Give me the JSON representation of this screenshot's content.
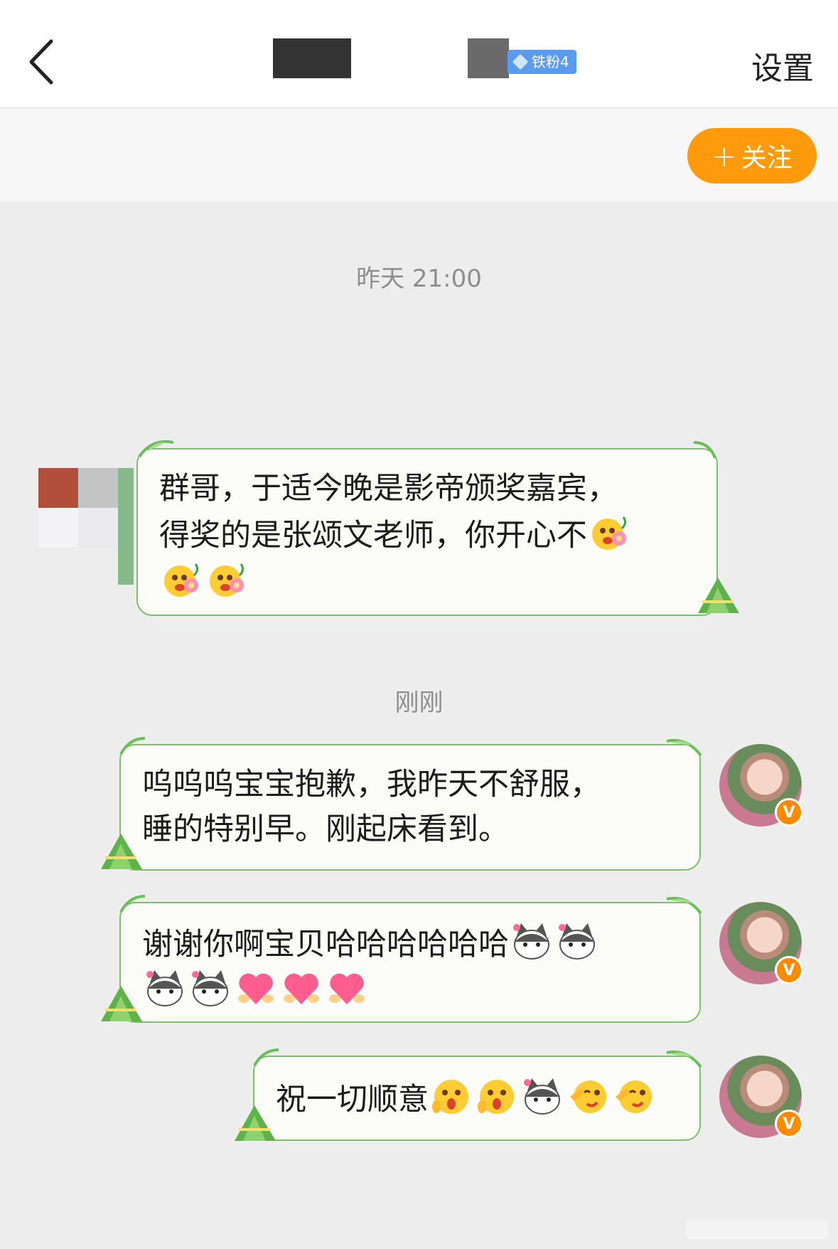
{
  "header": {
    "settings_label": "设置",
    "fan_badge": "铁粉4"
  },
  "follow_button": {
    "label": "关注",
    "icon": "plus-icon"
  },
  "timestamps": [
    "昨天 21:00",
    "刚刚"
  ],
  "messages": [
    {
      "side": "left",
      "line1": "群哥，于适今晚是影帝颁奖嘉宾，",
      "line2": "得奖的是张颂文老师，你开心不",
      "emojis_line2": [
        "flower-face-emoji"
      ],
      "emojis_line3": [
        "flower-face-emoji",
        "flower-face-emoji"
      ]
    },
    {
      "side": "right",
      "line1": "呜呜呜宝宝抱歉，我昨天不舒服，",
      "line2": "睡的特别早。刚起床看到。"
    },
    {
      "side": "right",
      "line1": "谢谢你啊宝贝哈哈哈哈哈哈",
      "emojis_line1": [
        "cat-emoji",
        "cat-emoji"
      ],
      "emojis_line2": [
        "cat-emoji",
        "cat-emoji",
        "heart-emoji",
        "heart-emoji",
        "heart-emoji"
      ]
    },
    {
      "side": "right",
      "line1": "祝一切顺意",
      "emojis_line1": [
        "surprised-face-emoji",
        "surprised-face-emoji",
        "cat-emoji",
        "salute-face-emoji",
        "salute-face-emoji"
      ]
    }
  ],
  "avatar_badge": "V",
  "colors": {
    "accent": "#ff9a0c",
    "bubble_border": "#7cbf6a",
    "badge_blue": "#5a9bf0",
    "verified": "#ff8a00"
  }
}
